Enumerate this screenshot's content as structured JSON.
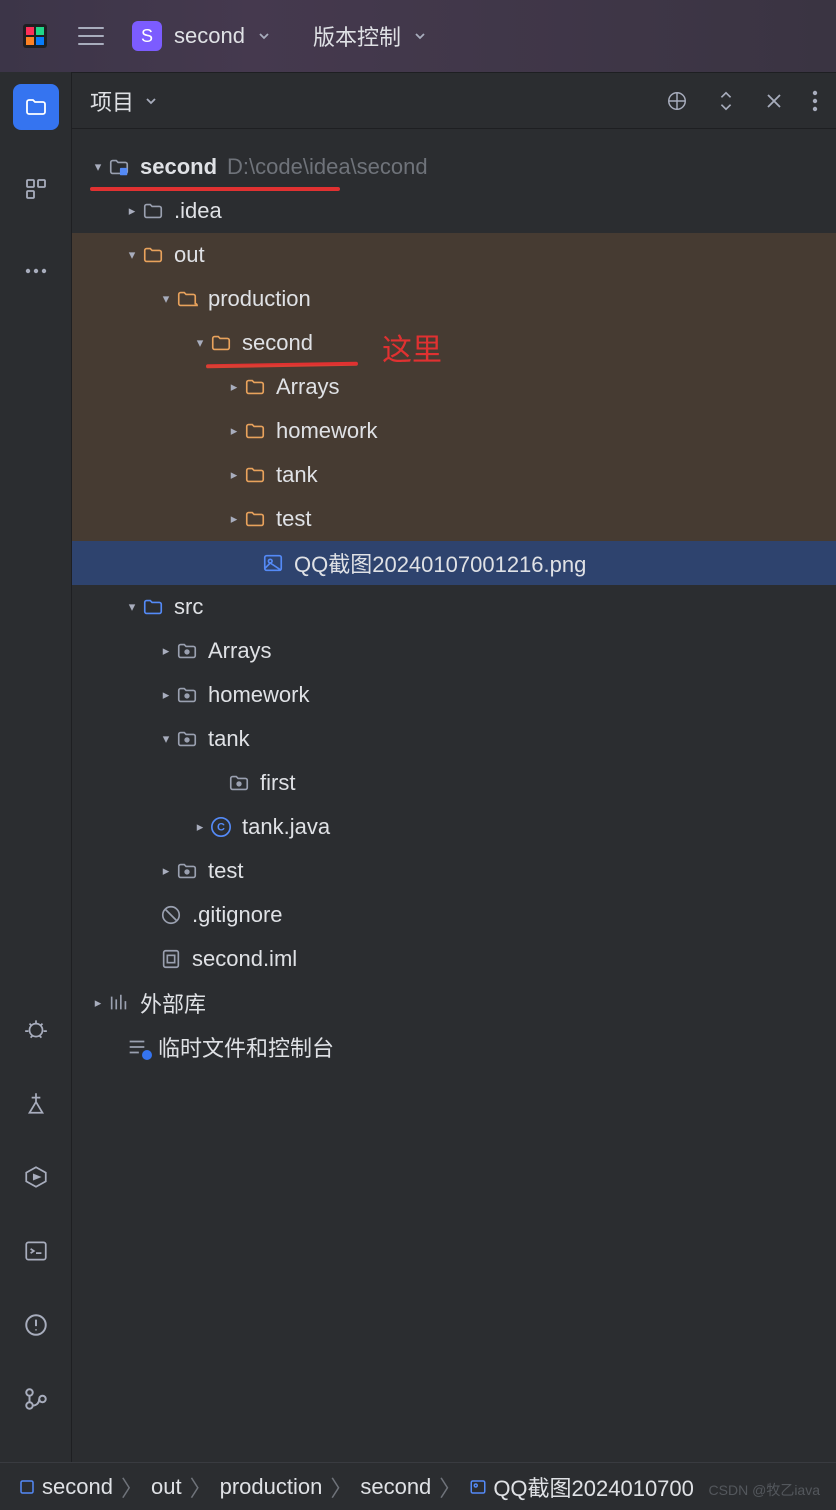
{
  "titlebar": {
    "project_letter": "S",
    "project_name": "second",
    "vcs_label": "版本控制"
  },
  "panel": {
    "title": "项目"
  },
  "tree": {
    "root": {
      "name": "second",
      "path": "D:\\code\\idea\\second"
    },
    "idea": ".idea",
    "out": "out",
    "production": "production",
    "second_out": "second",
    "arrays_out": "Arrays",
    "homework_out": "homework",
    "tank_out": "tank",
    "test_out": "test",
    "png": "QQ截图20240107001216.png",
    "src": "src",
    "arrays_src": "Arrays",
    "homework_src": "homework",
    "tank_src": "tank",
    "first": "first",
    "tank_java": "tank.java",
    "test_src": "test",
    "gitignore": ".gitignore",
    "iml": "second.iml",
    "external": "外部库",
    "scratches": "临时文件和控制台"
  },
  "annotations": {
    "here": "这里"
  },
  "breadcrumbs": {
    "items": [
      "second",
      "out",
      "production",
      "second",
      "QQ截图2024010700"
    ]
  },
  "watermark": "CSDN @牧乙iava"
}
